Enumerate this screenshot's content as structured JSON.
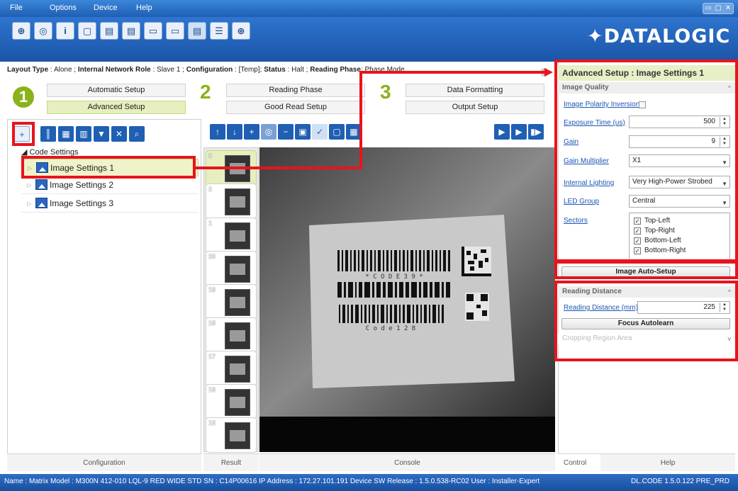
{
  "menu": [
    "File",
    "Options",
    "Device",
    "Help"
  ],
  "window_controls": [
    "▭",
    "▢",
    "✕"
  ],
  "toolbar_icons": [
    "crosshair-icon",
    "scan-icon",
    "info-icon",
    "window-icon",
    "reader-icon",
    "reader-config-icon",
    "monitor-icon",
    "monitor-alt-icon",
    "reader-export-icon",
    "reader-list-icon",
    "target-icon"
  ],
  "logo": "DATALOGIC",
  "info": {
    "layout_type_label": "Layout Type",
    "layout_type_value": "Alone ;",
    "network_role_label": "Internal Network Role",
    "network_role_value": "Slave 1 ;",
    "configuration_label": "Configuration",
    "configuration_value": "[Temp];",
    "status_label": "Status",
    "status_value": "Halt ;",
    "reading_phase_label": "Reading Phase",
    "reading_phase_value": "Phase Mode"
  },
  "steps": {
    "one": "1",
    "two": "2",
    "three": "3",
    "automatic_setup": "Automatic Setup",
    "advanced_setup": "Advanced Setup",
    "reading_phase": "Reading Phase",
    "good_read_setup": "Good Read Setup",
    "data_formatting": "Data Formatting",
    "output_setup": "Output Setup"
  },
  "tree": {
    "root": "Code Settings",
    "items": [
      "Image Settings  1",
      "Image Settings  2",
      "Image Settings  3"
    ]
  },
  "left_footer": "Configuration",
  "thumbnails": [
    "5",
    "2",
    "1",
    "20",
    "19",
    "18",
    "17",
    "16",
    "15"
  ],
  "center_footer": {
    "result": "Result",
    "console": "Console"
  },
  "right": {
    "title": "Advanced Setup : Image Settings  1",
    "image_quality": "Image Quality",
    "polarity_label": "Image Polarity Inversion",
    "exposure_label": "Exposure Time (us)",
    "exposure_value": "500",
    "gain_label": "Gain",
    "gain_value": "9",
    "gain_mult_label": "Gain Multiplier",
    "gain_mult_value": "X1",
    "lighting_label": "Internal Lighting",
    "lighting_value": "Very High-Power Strobed",
    "led_label": "LED Group",
    "led_value": "Central",
    "sectors_label": "Sectors",
    "sectors": [
      "Top-Left",
      "Top-Right",
      "Bottom-Left",
      "Bottom-Right"
    ],
    "auto_setup_btn": "Image Auto-Setup",
    "reading_distance_section": "Reading Distance",
    "reading_distance_label": "Reading Distance (mm)",
    "reading_distance_value": "225",
    "focus_btn": "Focus Autolearn",
    "cropping": "Cropping Region Area",
    "tab_control": "Control",
    "tab_help": "Help"
  },
  "status_bar": {
    "left": "Name : Matrix  Model : M300N 412-010 LQL-9 RED WIDE STD   SN : C14P00616   IP Address :  172.27.101.191   Device SW Release : 1.5.0.538-RC02   User : Installer-Expert",
    "right": "DL.CODE 1.5.0.122 PRE_PRD"
  },
  "barcode_text": {
    "code39": "* C O D E  3 9 *",
    "code128": "C o d e  1 2 8"
  },
  "colors": {
    "accent_red": "#e8141b",
    "brand_blue": "#1f5fb4",
    "step_green": "#8ab21a"
  }
}
